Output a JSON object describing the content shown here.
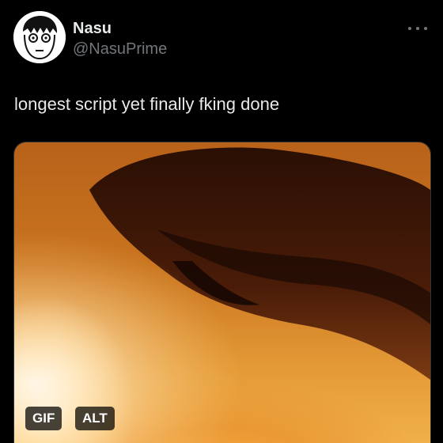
{
  "author": {
    "display_name": "Nasu",
    "handle": "@NasuPrime",
    "avatar_icon": "cartoon-face-avatar"
  },
  "header": {
    "more_icon": "more-horizontal-icon"
  },
  "tweet": {
    "text": "longest script yet finally fking done"
  },
  "media": {
    "type": "gif",
    "gif_label": "GIF",
    "alt_label": "ALT"
  },
  "colors": {
    "background": "#000000",
    "primary_text": "#e7e9ea",
    "secondary_text": "#71767b",
    "badge_bg": "#000000b8"
  }
}
